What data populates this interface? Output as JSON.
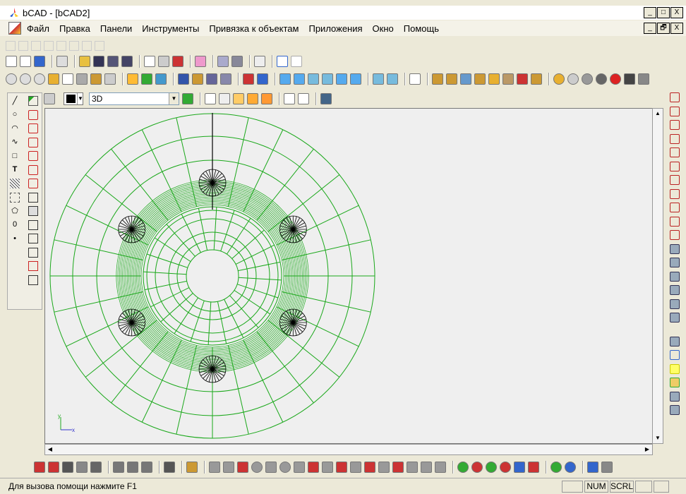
{
  "window": {
    "title": "bCAD - [bCAD2]",
    "controls": {
      "minimize": "_",
      "maximize": "□",
      "close": "X",
      "restore": "🗗"
    }
  },
  "menu": {
    "items": [
      "Файл",
      "Правка",
      "Панели",
      "Инструменты",
      "Привязка к объектам",
      "Приложения",
      "Окно",
      "Помощь"
    ]
  },
  "property_bar": {
    "view_select": "3D",
    "color": "#000000"
  },
  "canvas": {
    "wire_color": "#1aa81a",
    "axis_labels": {
      "x": "x",
      "y": "y"
    }
  },
  "left_tools": [
    "line-icon",
    "circle-icon",
    "arc-icon",
    "spline-icon",
    "rectangle-icon",
    "text-icon",
    "hatch-icon",
    "block-icon",
    "polygon-icon",
    "ellipse-icon",
    "point-icon"
  ],
  "status": {
    "help_text": "Для вызова помощи нажмите F1",
    "num": "NUM",
    "scrl": "SCRL"
  }
}
